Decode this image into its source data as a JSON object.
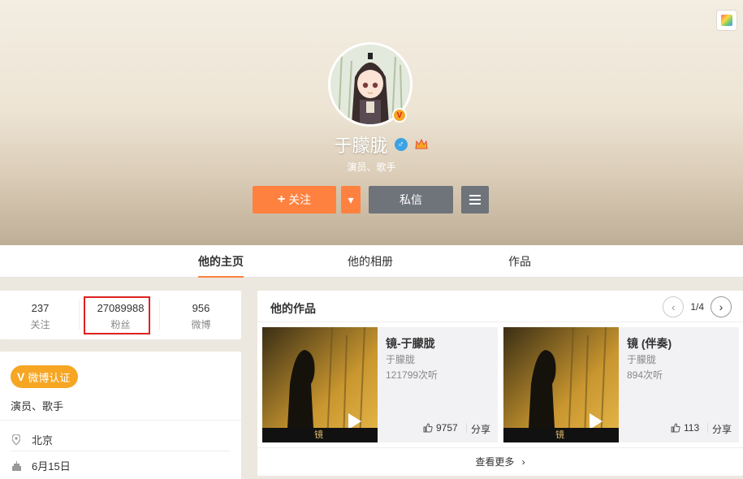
{
  "header": {
    "name": "于朦胧",
    "gender_symbol": "♂",
    "verify_badge": "V",
    "intro": "演员、歌手",
    "follow_label": "关注",
    "follow_plus": "+",
    "follow_more_symbol": "▾",
    "message_label": "私信",
    "menu_symbol": "≡"
  },
  "tabs": [
    {
      "label": "他的主页",
      "active": true
    },
    {
      "label": "他的相册",
      "active": false
    },
    {
      "label": "作品",
      "active": false
    }
  ],
  "stats": [
    {
      "value": "237",
      "label": "关注"
    },
    {
      "value": "27089988",
      "label": "粉丝"
    },
    {
      "value": "956",
      "label": "微博"
    }
  ],
  "info": {
    "verify_icon": "V",
    "verify_label": "微博认证",
    "verify_desc": "演员、歌手",
    "location": "北京",
    "birthday": "6月15日"
  },
  "works": {
    "title": "他的作品",
    "page": "1/4",
    "prev_symbol": "‹",
    "next_symbol": "›",
    "items": [
      {
        "title": "镜-于朦胧",
        "artist": "于朦胧",
        "plays": "121799次听",
        "likes": "9757",
        "share": "分享",
        "cover_char": "镜"
      },
      {
        "title": "镜 (伴奏)",
        "artist": "于朦胧",
        "plays": "894次听",
        "likes": "113",
        "share": "分享",
        "cover_char": "镜"
      }
    ],
    "more_label": "查看更多",
    "more_arrow": "›"
  },
  "colors": {
    "accent": "#ff8140",
    "dark_button": "#6f737a",
    "verify": "#f6a623",
    "highlight_box": "#e02020"
  },
  "icons": [
    "skin-icon",
    "gender-male-icon",
    "crown-icon",
    "verified-badge-icon",
    "location-icon",
    "birthday-cake-icon",
    "thumbs-up-icon",
    "play-icon",
    "menu-icon",
    "chevron-left-icon",
    "chevron-right-icon"
  ]
}
